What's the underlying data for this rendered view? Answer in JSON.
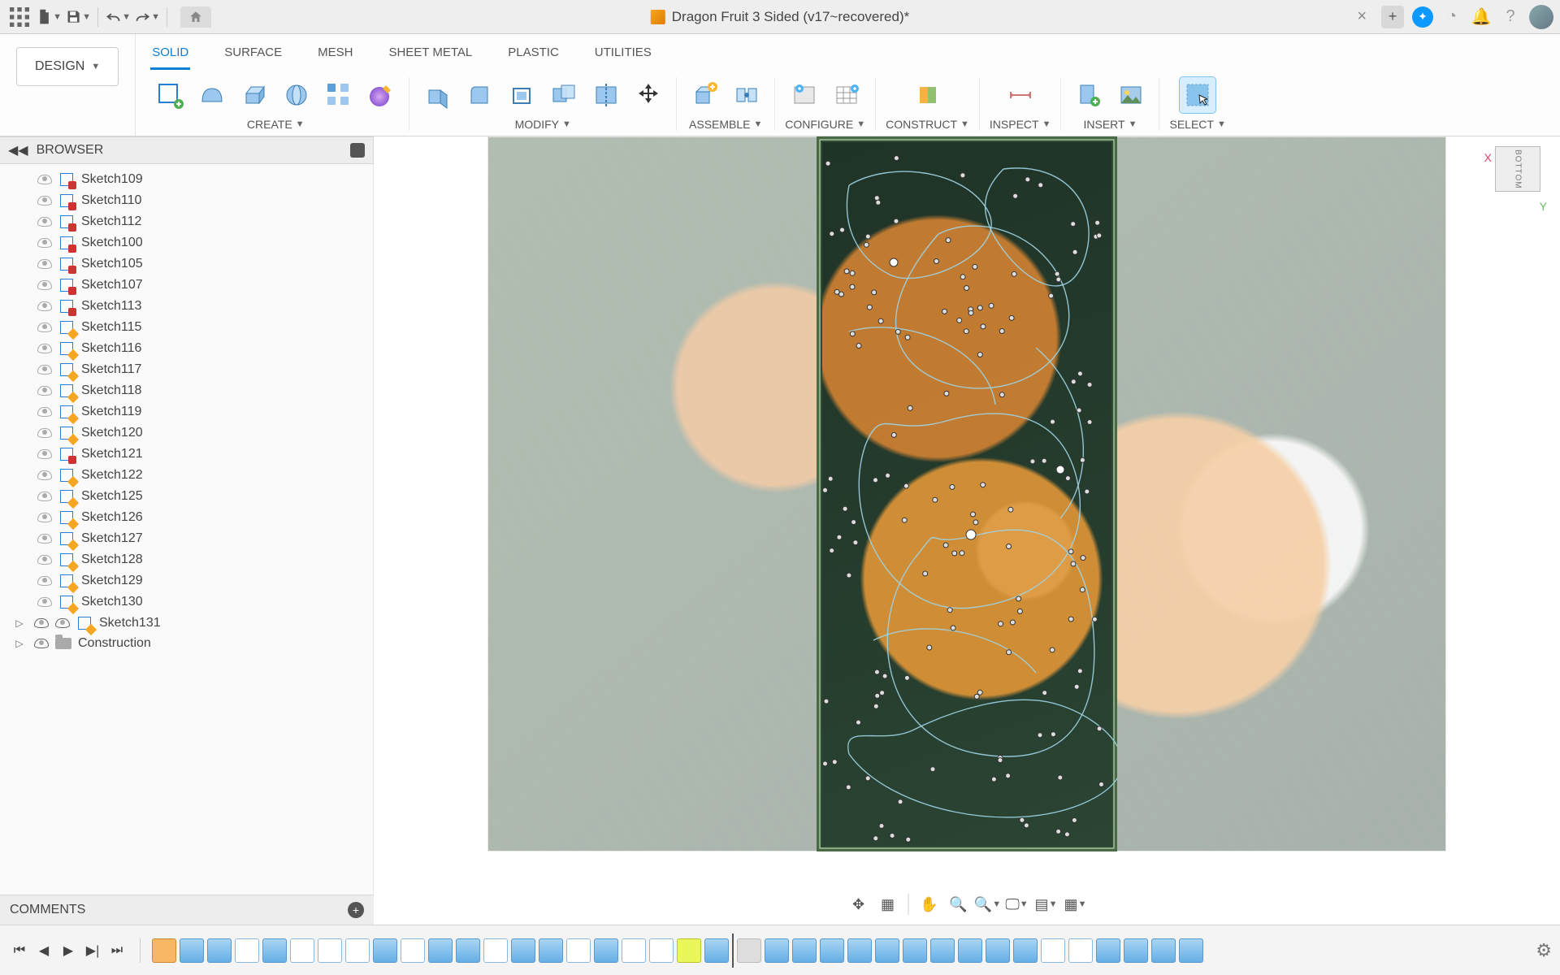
{
  "title": "Dragon Fruit 3 Sided (v17~recovered)*",
  "workspace_button": "DESIGN",
  "ribbon_tabs": [
    "SOLID",
    "SURFACE",
    "MESH",
    "SHEET METAL",
    "PLASTIC",
    "UTILITIES"
  ],
  "active_ribbon_tab": "SOLID",
  "ribbon_groups": {
    "create": "CREATE",
    "modify": "MODIFY",
    "assemble": "ASSEMBLE",
    "configure": "CONFIGURE",
    "construct": "CONSTRUCT",
    "inspect": "INSPECT",
    "insert": "INSERT",
    "select": "SELECT"
  },
  "browser_title": "BROWSER",
  "browser_items": [
    {
      "label": "Sketch109",
      "locked": true
    },
    {
      "label": "Sketch110",
      "locked": true
    },
    {
      "label": "Sketch112",
      "locked": true
    },
    {
      "label": "Sketch100",
      "locked": true
    },
    {
      "label": "Sketch105",
      "locked": true
    },
    {
      "label": "Sketch107",
      "locked": true
    },
    {
      "label": "Sketch113",
      "locked": true
    },
    {
      "label": "Sketch115",
      "locked": false
    },
    {
      "label": "Sketch116",
      "locked": false
    },
    {
      "label": "Sketch117",
      "locked": false
    },
    {
      "label": "Sketch118",
      "locked": false
    },
    {
      "label": "Sketch119",
      "locked": false
    },
    {
      "label": "Sketch120",
      "locked": false
    },
    {
      "label": "Sketch121",
      "locked": true
    },
    {
      "label": "Sketch122",
      "locked": false
    },
    {
      "label": "Sketch125",
      "locked": false
    },
    {
      "label": "Sketch126",
      "locked": false
    },
    {
      "label": "Sketch127",
      "locked": false
    },
    {
      "label": "Sketch128",
      "locked": false
    },
    {
      "label": "Sketch129",
      "locked": false
    },
    {
      "label": "Sketch130",
      "locked": false
    }
  ],
  "special_items": [
    {
      "label": "Sketch131"
    },
    {
      "label": "Construction"
    }
  ],
  "comments_title": "COMMENTS",
  "viewcube_face": "BOTTOM",
  "axis_x": "X",
  "axis_y": "Y",
  "timeline_controls": [
    "⏮",
    "◀",
    "▶",
    "⏭",
    "⏯"
  ],
  "timeline_item_count": 38,
  "timeline_styles": [
    "orange",
    "blue",
    "blue",
    "out",
    "blue",
    "out",
    "out",
    "out",
    "blue",
    "out",
    "blue",
    "blue",
    "out",
    "blue",
    "blue",
    "out",
    "blue",
    "out",
    "out",
    "yl",
    "blue",
    "gray",
    "blue",
    "blue",
    "blue",
    "blue",
    "blue",
    "blue",
    "blue",
    "blue",
    "blue",
    "blue",
    "out",
    "out",
    "blue",
    "blue",
    "blue",
    "blue"
  ],
  "timeline_marker_index": 21
}
